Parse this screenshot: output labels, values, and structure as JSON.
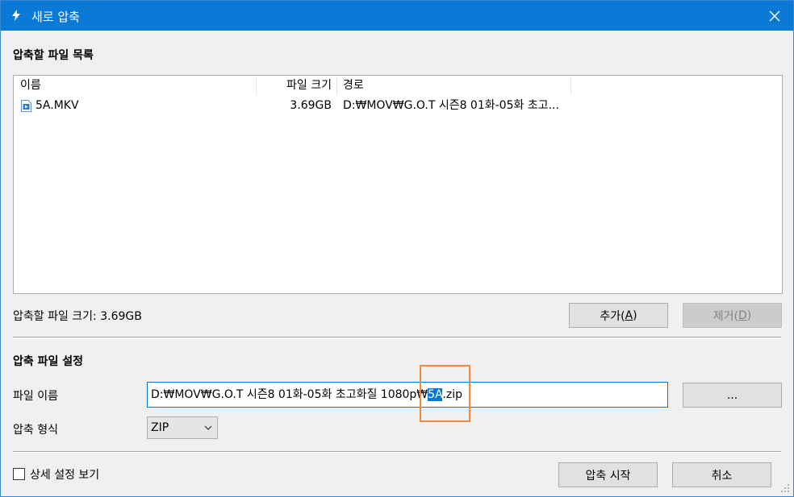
{
  "window": {
    "title": "새로 압축",
    "icons": {
      "app": "bolt-icon",
      "close": "close-icon"
    }
  },
  "filelist_section": {
    "title": "압축할 파일 목록",
    "columns": [
      "이름",
      "파일 크기",
      "경로"
    ],
    "rows": [
      {
        "name": "5A.MKV",
        "size": "3.69GB",
        "path": "D:₩MOV₩G.O.T 시즌8 01화-05화 초고..."
      }
    ],
    "total_size_label": "압축할 파일 크기: 3.69GB",
    "add_label_pre": "추가(",
    "add_key": "A",
    "add_label_post": ")",
    "remove_label_pre": "제거(",
    "remove_key": "D",
    "remove_label_post": ")"
  },
  "settings_section": {
    "title": "압축 파일 설정",
    "filename_label": "파일 이름",
    "filename_pre": "D:₩MOV₩G.O.T 시즌8 01화-05화 초고화질 1080p₩",
    "filename_selected": "5A",
    "filename_post": ".zip",
    "browse_label": "...",
    "format_label": "압축 형식",
    "format_value": "ZIP"
  },
  "footer": {
    "details_label": "상세 설정 보기",
    "start_label": "압축 시작",
    "cancel_label": "취소"
  },
  "colors": {
    "titlebar": "#0a7ad6",
    "selection": "#0078d7",
    "highlight": "#f0883e"
  }
}
